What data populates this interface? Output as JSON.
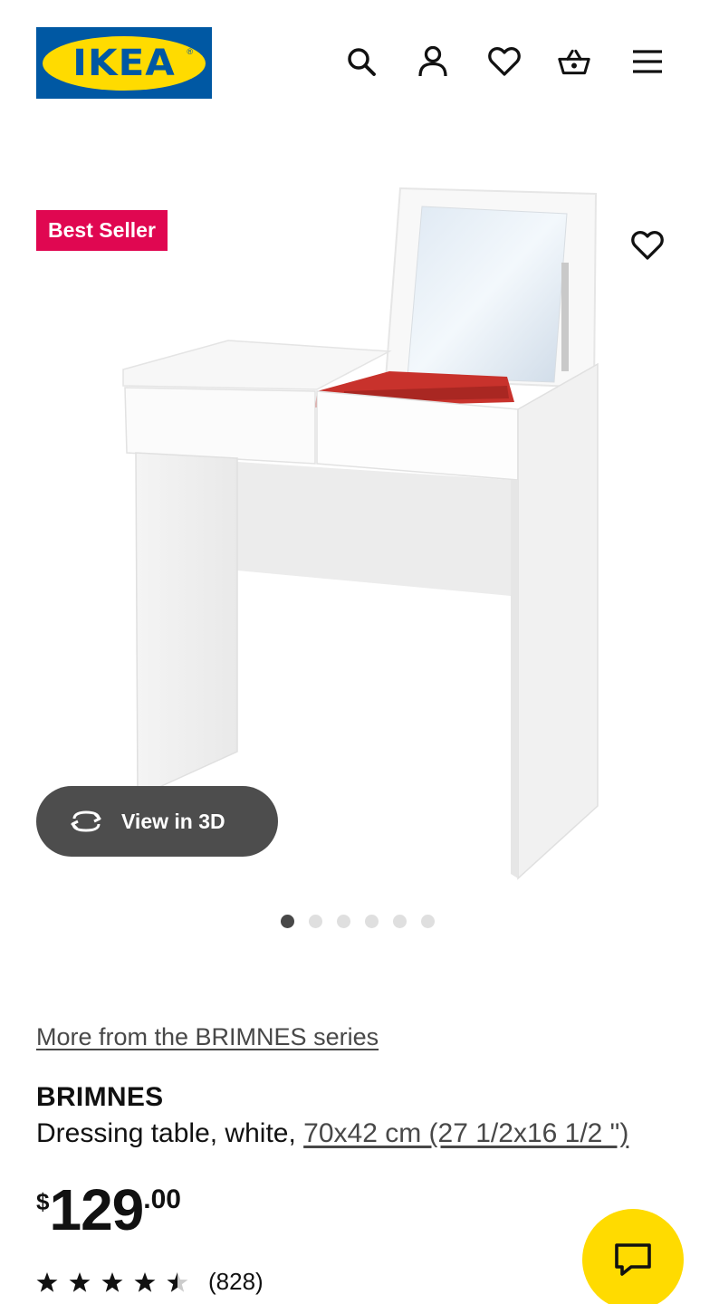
{
  "header": {
    "logo_text": "IKEA",
    "icons": [
      "search-icon",
      "account-icon",
      "heart-icon",
      "basket-icon",
      "menu-icon"
    ]
  },
  "product_media": {
    "badge": "Best Seller",
    "view_3d_label": "View in 3D",
    "image_count": 6,
    "active_image": 1
  },
  "product": {
    "series_link": "More from the BRIMNES series",
    "name": "BRIMNES",
    "description_prefix": "Dressing table, white, ",
    "size_link": "70x42 cm (27 1/2x16 1/2 \")",
    "price": {
      "currency": "$",
      "integer": "129",
      "decimal": ".00"
    },
    "rating": {
      "stars": 4.5,
      "count_label": "(828)"
    }
  },
  "colors": {
    "ikea_blue": "#0058a3",
    "ikea_yellow": "#ffdb00",
    "badge_red": "#e00751",
    "view3d_bg": "#4d4d4d"
  }
}
